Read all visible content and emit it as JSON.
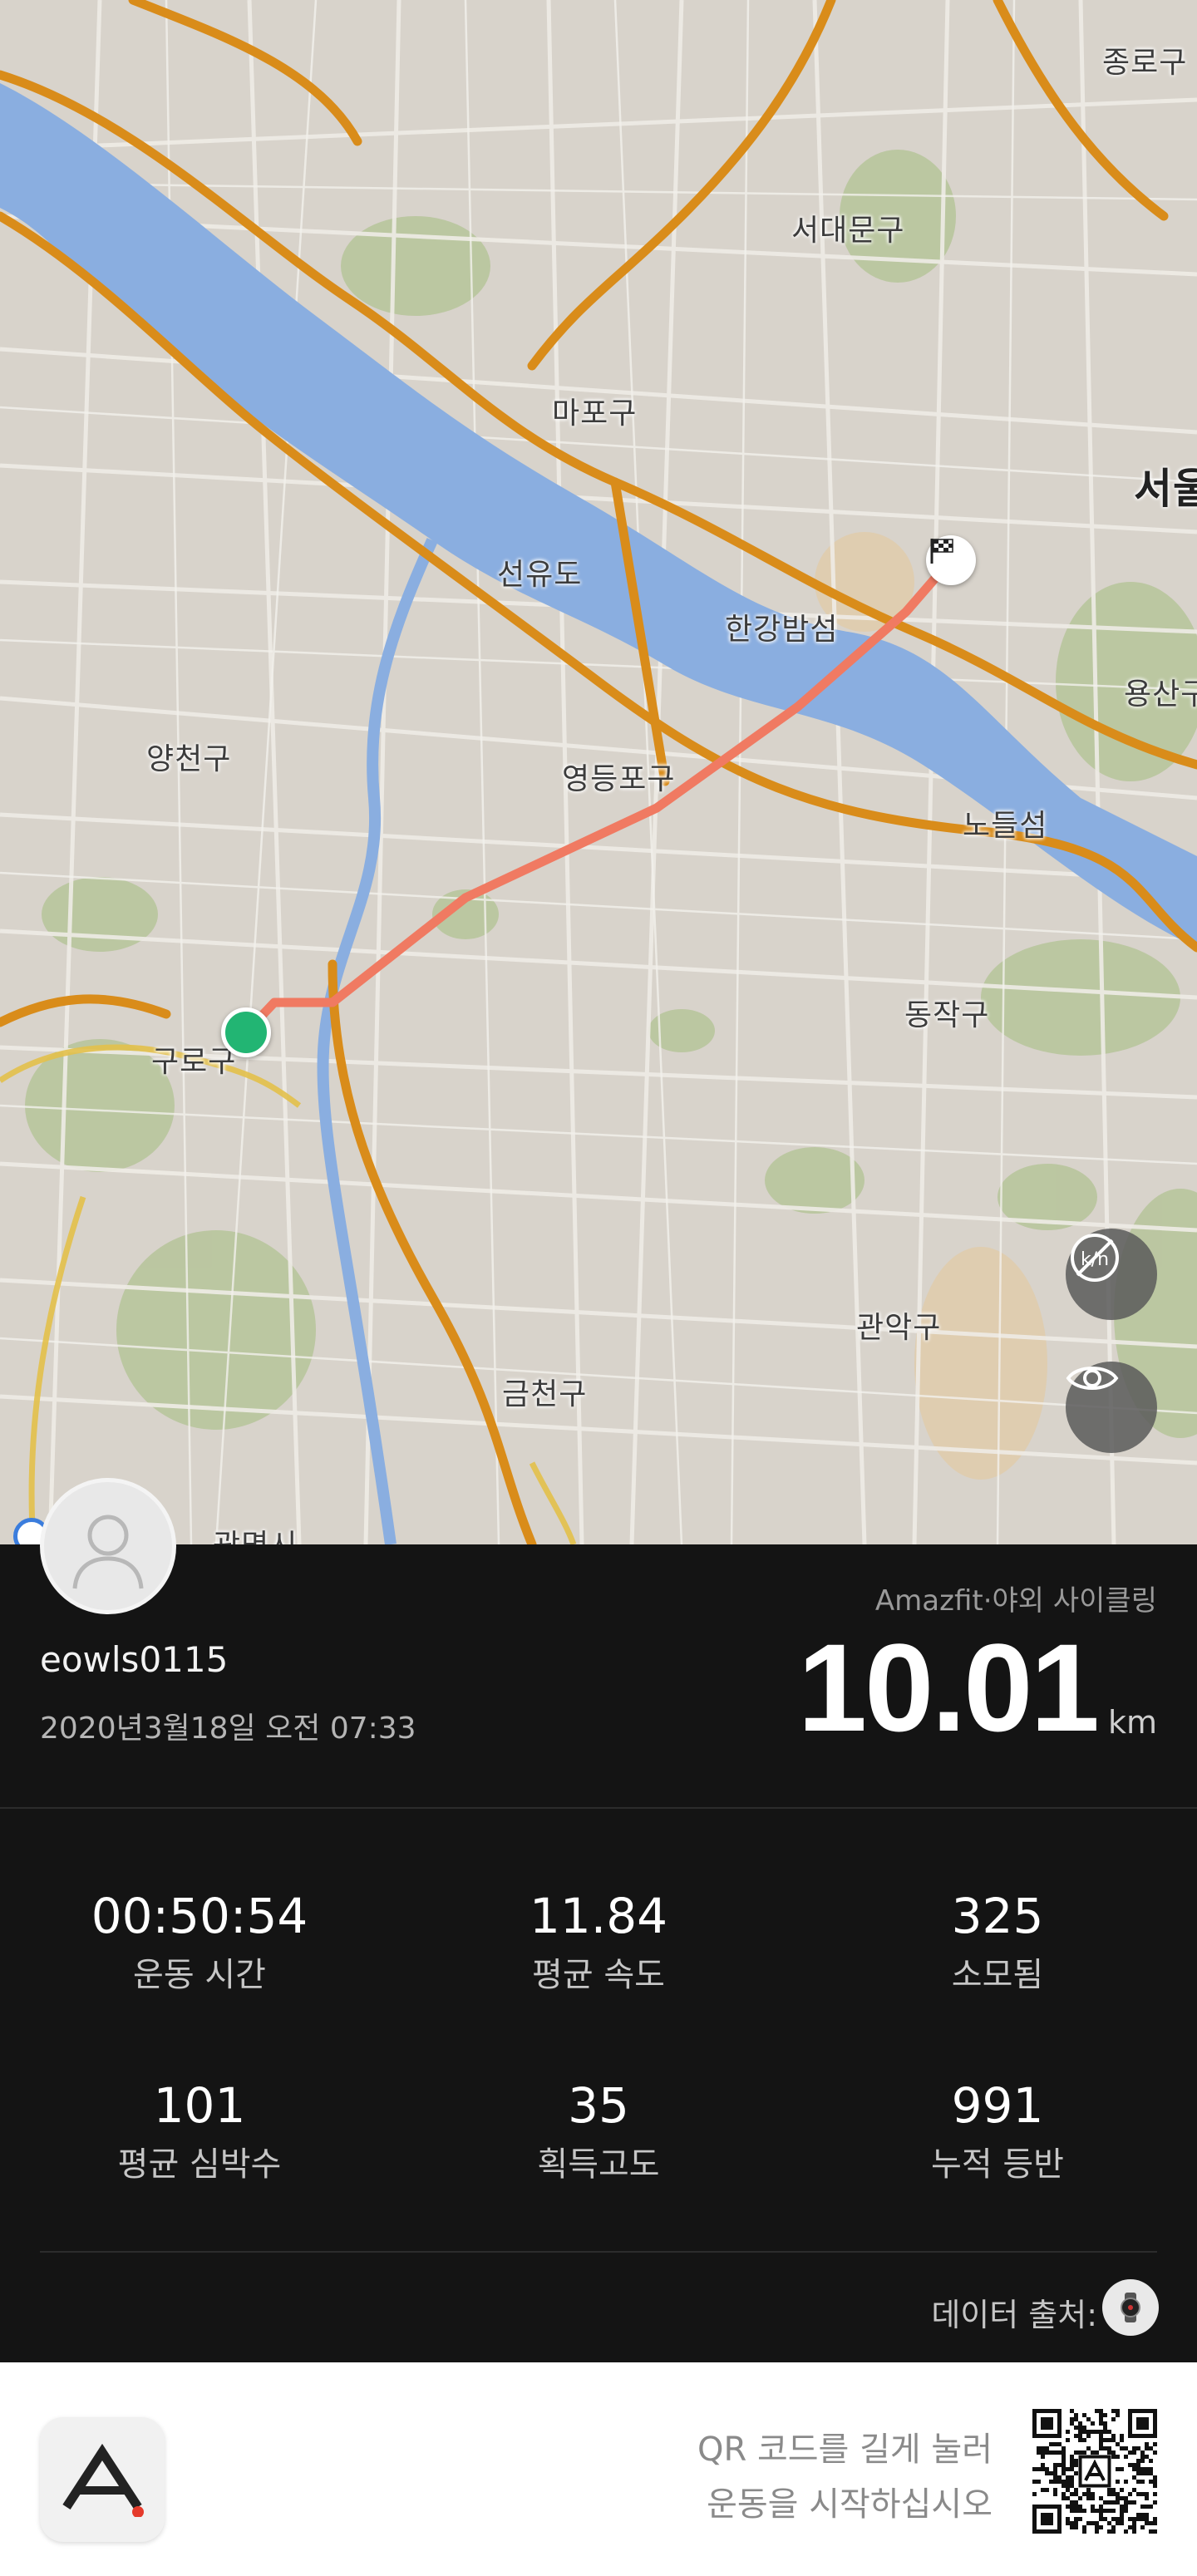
{
  "map": {
    "labels": [
      {
        "id": "jongno",
        "text": "종로구"
      },
      {
        "id": "seodaemun",
        "text": "서대문구"
      },
      {
        "id": "mapo",
        "text": "마포구"
      },
      {
        "id": "seoul",
        "text": "서울"
      },
      {
        "id": "seonyudo",
        "text": "선유도"
      },
      {
        "id": "hangang-bamseom",
        "text": "한강밤섬"
      },
      {
        "id": "yongsan",
        "text": "용산구"
      },
      {
        "id": "yangcheon",
        "text": "양천구"
      },
      {
        "id": "yeongdeungpo",
        "text": "영등포구"
      },
      {
        "id": "nodeulseom",
        "text": "노들섬"
      },
      {
        "id": "dongjak",
        "text": "동작구"
      },
      {
        "id": "guro",
        "text": "구로구"
      },
      {
        "id": "gwanak",
        "text": "관악구"
      },
      {
        "id": "geumcheon",
        "text": "금천구"
      },
      {
        "id": "gwangmyeong",
        "text": "광명시"
      }
    ],
    "buttons": {
      "unit_toggle_icon": "km-mi-off-icon",
      "visibility_icon": "eye-icon"
    },
    "colors": {
      "route": "#f07a62",
      "start": "#22b573",
      "river": "#8aaee0",
      "highway": "#d98c1a",
      "park": "#aebf8e"
    }
  },
  "user": {
    "username": "eowls0115",
    "datetime": "2020년3월18일 오전 07:33"
  },
  "workout": {
    "source_app": "Amazfit·야외 사이클링",
    "distance": "10.01",
    "distance_unit": "km"
  },
  "stats": [
    {
      "value": "00:50:54",
      "label": "운동 시간"
    },
    {
      "value": "11.84",
      "label": "평균 속도"
    },
    {
      "value": "325",
      "label": "소모됨"
    },
    {
      "value": "101",
      "label": "평균 심박수"
    },
    {
      "value": "35",
      "label": "획득고도"
    },
    {
      "value": "991",
      "label": "누적 등반"
    }
  ],
  "data_source": {
    "label": "데이터 출처:",
    "icon": "watch-icon"
  },
  "footer": {
    "qr_line1": "QR 코드를 길게 눌러",
    "qr_line2": "운동을 시작하십시오",
    "logo_icon": "amazfit-logo-icon",
    "accent": "#e53a2b"
  }
}
